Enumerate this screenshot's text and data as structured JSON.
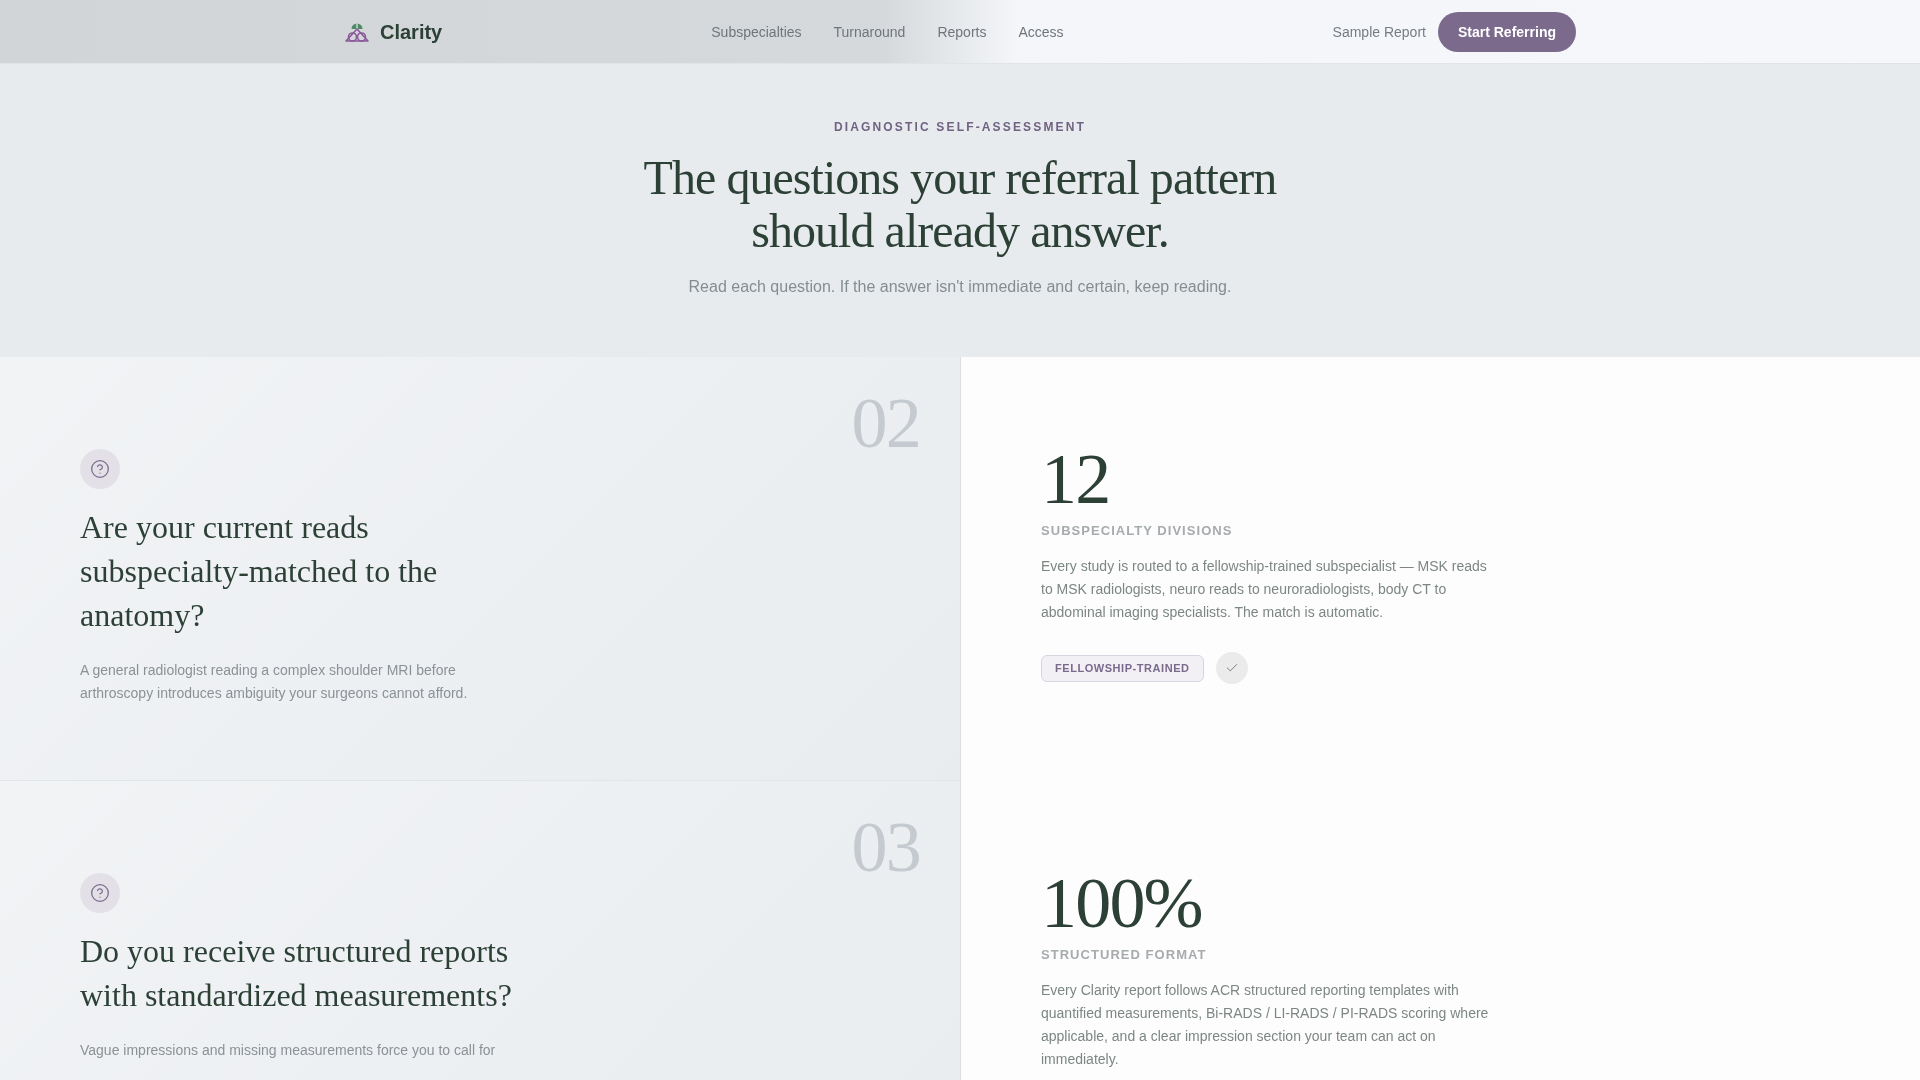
{
  "nav": {
    "brand": "Clarity",
    "links": [
      "Subspecialties",
      "Turnaround",
      "Reports",
      "Access"
    ],
    "secondary_link": "Sample Report",
    "cta": "Start Referring"
  },
  "hero": {
    "eyebrow": "DIAGNOSTIC SELF-ASSESSMENT",
    "title": "The questions your referral pattern should already answer.",
    "subtitle": "Read each question. If the answer isn't immediate and certain, keep reading."
  },
  "rows": [
    {
      "question": {
        "number": "02",
        "title": "Are your current reads subspecialty-matched to the anatomy?",
        "text": "A general radiologist reading a complex shoulder MRI before arthroscopy introduces ambiguity your surgeons cannot afford."
      },
      "answer": {
        "stat": "12",
        "label": "SUBSPECIALTY DIVISIONS",
        "text": "Every study is routed to a fellowship-trained subspecialist — MSK reads to MSK radiologists, neuro reads to neuroradiologists, body CT to abdominal imaging specialists. The match is automatic.",
        "tag": "FELLOWSHIP-TRAINED"
      }
    },
    {
      "question": {
        "number": "03",
        "title": "Do you receive structured reports with standardized measurements?",
        "text": "Vague impressions and missing measurements force you to call for"
      },
      "answer": {
        "stat": "100%",
        "label": "STRUCTURED FORMAT",
        "text": "Every Clarity report follows ACR structured reporting templates with quantified measurements, Bi-RADS / LI-RADS / PI-RADS scoring where applicable, and a clear impression section your team can act on immediately."
      }
    }
  ]
}
